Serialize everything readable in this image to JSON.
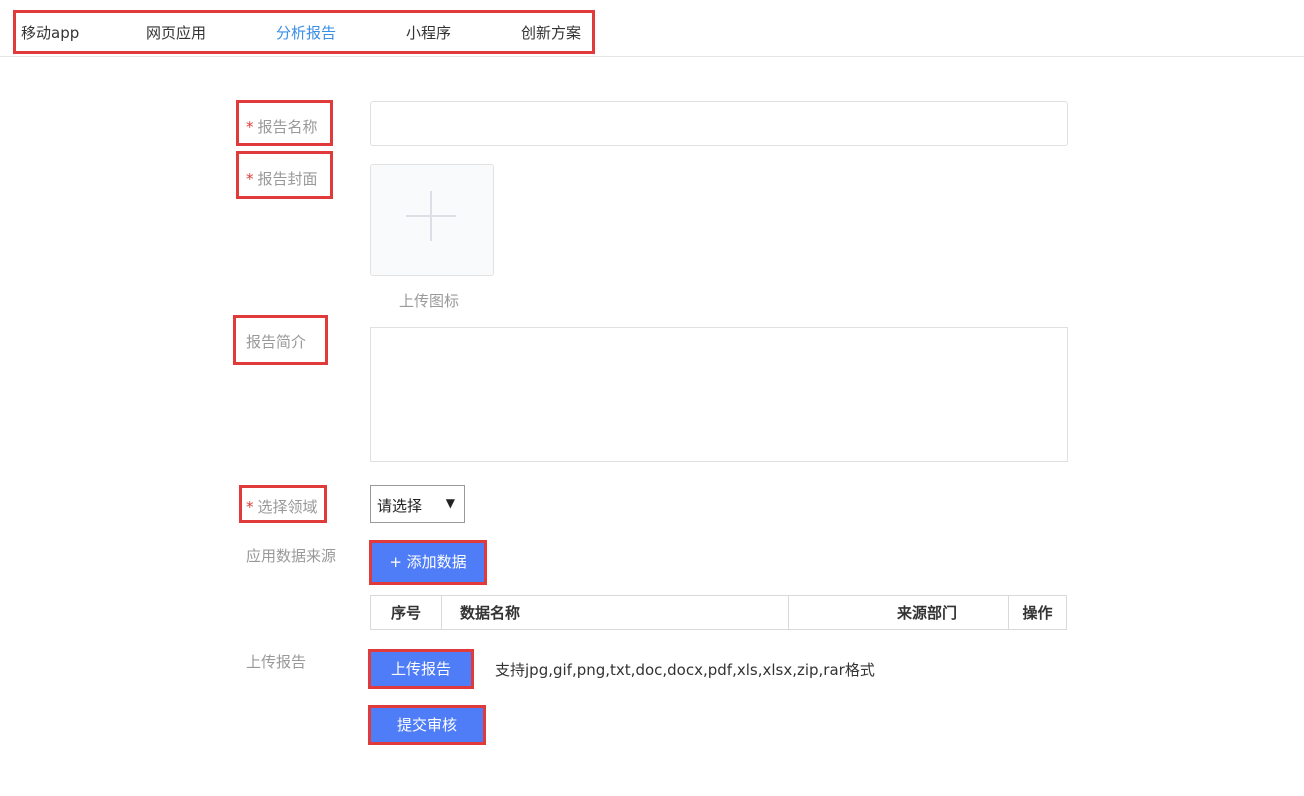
{
  "nav": {
    "items": [
      {
        "label": "移动app"
      },
      {
        "label": "网页应用"
      },
      {
        "label": "分析报告"
      },
      {
        "label": "小程序"
      },
      {
        "label": "创新方案"
      }
    ],
    "active_index": 2
  },
  "form": {
    "required_mark": "*",
    "report_name": {
      "label": "报告名称",
      "value": ""
    },
    "cover": {
      "label": "报告封面",
      "upload_caption": "上传图标"
    },
    "intro": {
      "label": "报告简介",
      "value": ""
    },
    "domain": {
      "label": "选择领域",
      "selected": "请选择"
    },
    "data_source": {
      "label": "应用数据来源",
      "add_button": "+ 添加数据"
    },
    "table": {
      "headers": [
        "序号",
        "数据名称",
        "来源部门",
        "操作"
      ]
    },
    "upload_report": {
      "label": "上传报告",
      "button": "上传报告",
      "hint": "支持jpg,gif,png,txt,doc,docx,pdf,xls,xlsx,zip,rar格式"
    },
    "submit_button": "提交审核"
  },
  "colors": {
    "accent": "#4f7cf7",
    "active_nav": "#3a8ee6",
    "required": "#e03a3a",
    "label": "#999999"
  }
}
